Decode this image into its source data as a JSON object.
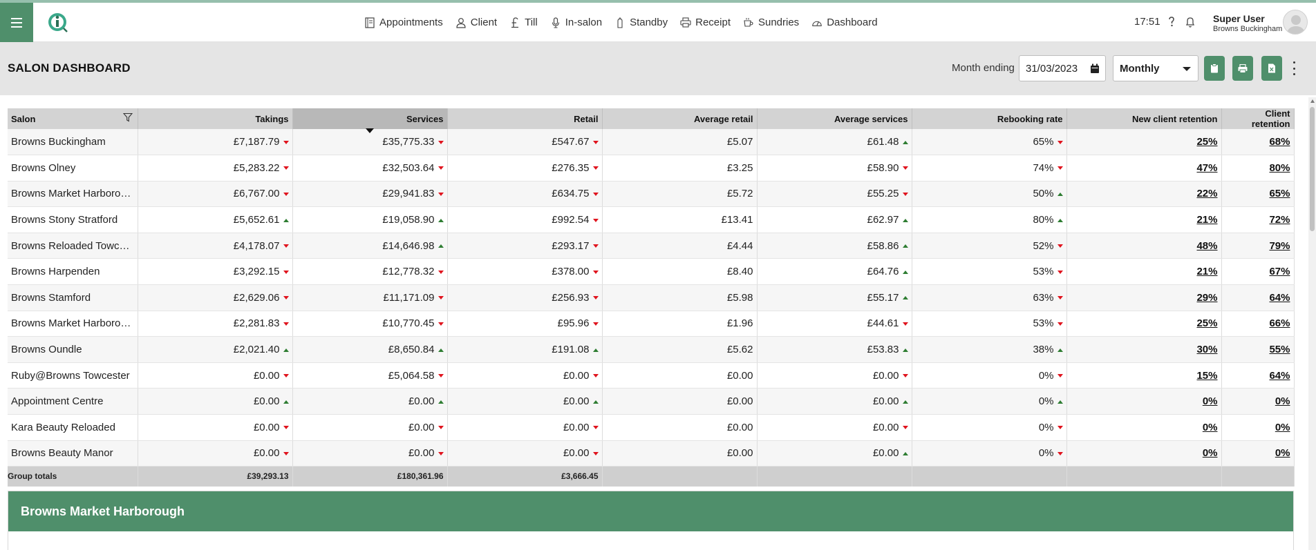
{
  "nav": {
    "items": [
      {
        "label": "Appointments",
        "icon": "book-icon"
      },
      {
        "label": "Client",
        "icon": "user-icon"
      },
      {
        "label": "Till",
        "icon": "pound-icon"
      },
      {
        "label": "In-salon",
        "icon": "microphone-icon"
      },
      {
        "label": "Standby",
        "icon": "hand-icon"
      },
      {
        "label": "Receipt",
        "icon": "printer-icon"
      },
      {
        "label": "Sundries",
        "icon": "coffee-icon"
      },
      {
        "label": "Dashboard",
        "icon": "gauge-icon"
      }
    ]
  },
  "header": {
    "time": "17:51",
    "user_name": "Super User",
    "user_salon": "Browns Buckingham"
  },
  "subbar": {
    "title": "SALON DASHBOARD",
    "month_label": "Month ending",
    "date_value": "31/03/2023",
    "period_value": "Monthly"
  },
  "table": {
    "columns": [
      "Salon",
      "Takings",
      "Services",
      "Retail",
      "Average retail",
      "Average services",
      "Rebooking rate",
      "New client retention",
      "Client retention"
    ],
    "rows": [
      {
        "salon": "Browns Buckingham",
        "takings": "£7,187.79",
        "takings_dir": "down",
        "services": "£35,775.33",
        "services_dir": "down",
        "retail": "£547.67",
        "retail_dir": "down",
        "avg_retail": "£5.07",
        "avg_services": "£61.48",
        "avg_services_dir": "up",
        "rebooking": "65%",
        "rebooking_dir": "down",
        "new_retention": "25%",
        "retention": "68%"
      },
      {
        "salon": "Browns Olney",
        "takings": "£5,283.22",
        "takings_dir": "down",
        "services": "£32,503.64",
        "services_dir": "down",
        "retail": "£276.35",
        "retail_dir": "down",
        "avg_retail": "£3.25",
        "avg_services": "£58.90",
        "avg_services_dir": "down",
        "rebooking": "74%",
        "rebooking_dir": "down",
        "new_retention": "47%",
        "retention": "80%"
      },
      {
        "salon": "Browns Market Harborough",
        "takings": "£6,767.00",
        "takings_dir": "down",
        "services": "£29,941.83",
        "services_dir": "down",
        "retail": "£634.75",
        "retail_dir": "down",
        "avg_retail": "£5.72",
        "avg_services": "£55.25",
        "avg_services_dir": "down",
        "rebooking": "50%",
        "rebooking_dir": "up",
        "new_retention": "22%",
        "retention": "65%"
      },
      {
        "salon": "Browns Stony Stratford",
        "takings": "£5,652.61",
        "takings_dir": "up",
        "services": "£19,058.90",
        "services_dir": "up",
        "retail": "£992.54",
        "retail_dir": "down",
        "avg_retail": "£13.41",
        "avg_services": "£62.97",
        "avg_services_dir": "up",
        "rebooking": "80%",
        "rebooking_dir": "up",
        "new_retention": "21%",
        "retention": "72%"
      },
      {
        "salon": "Browns Reloaded Towcester",
        "takings": "£4,178.07",
        "takings_dir": "down",
        "services": "£14,646.98",
        "services_dir": "up",
        "retail": "£293.17",
        "retail_dir": "down",
        "avg_retail": "£4.44",
        "avg_services": "£58.86",
        "avg_services_dir": "up",
        "rebooking": "52%",
        "rebooking_dir": "down",
        "new_retention": "48%",
        "retention": "79%"
      },
      {
        "salon": "Browns Harpenden",
        "takings": "£3,292.15",
        "takings_dir": "down",
        "services": "£12,778.32",
        "services_dir": "down",
        "retail": "£378.00",
        "retail_dir": "down",
        "avg_retail": "£8.40",
        "avg_services": "£64.76",
        "avg_services_dir": "up",
        "rebooking": "53%",
        "rebooking_dir": "down",
        "new_retention": "21%",
        "retention": "67%"
      },
      {
        "salon": "Browns Stamford",
        "takings": "£2,629.06",
        "takings_dir": "down",
        "services": "£11,171.09",
        "services_dir": "down",
        "retail": "£256.93",
        "retail_dir": "down",
        "avg_retail": "£5.98",
        "avg_services": "£55.17",
        "avg_services_dir": "up",
        "rebooking": "63%",
        "rebooking_dir": "down",
        "new_retention": "29%",
        "retention": "64%"
      },
      {
        "salon": "Browns Market Harborough",
        "takings": "£2,281.83",
        "takings_dir": "down",
        "services": "£10,770.45",
        "services_dir": "down",
        "retail": "£95.96",
        "retail_dir": "down",
        "avg_retail": "£1.96",
        "avg_services": "£44.61",
        "avg_services_dir": "down",
        "rebooking": "53%",
        "rebooking_dir": "down",
        "new_retention": "25%",
        "retention": "66%"
      },
      {
        "salon": "Browns Oundle",
        "takings": "£2,021.40",
        "takings_dir": "up",
        "services": "£8,650.84",
        "services_dir": "up",
        "retail": "£191.08",
        "retail_dir": "up",
        "avg_retail": "£5.62",
        "avg_services": "£53.83",
        "avg_services_dir": "up",
        "rebooking": "38%",
        "rebooking_dir": "up",
        "new_retention": "30%",
        "retention": "55%"
      },
      {
        "salon": "Ruby@Browns Towcester",
        "takings": "£0.00",
        "takings_dir": "down",
        "services": "£5,064.58",
        "services_dir": "down",
        "retail": "£0.00",
        "retail_dir": "down",
        "avg_retail": "£0.00",
        "avg_services": "£0.00",
        "avg_services_dir": "down",
        "rebooking": "0%",
        "rebooking_dir": "down",
        "new_retention": "15%",
        "retention": "64%"
      },
      {
        "salon": "Appointment Centre",
        "takings": "£0.00",
        "takings_dir": "up",
        "services": "£0.00",
        "services_dir": "up",
        "retail": "£0.00",
        "retail_dir": "up",
        "avg_retail": "£0.00",
        "avg_services": "£0.00",
        "avg_services_dir": "up",
        "rebooking": "0%",
        "rebooking_dir": "up",
        "new_retention": "0%",
        "retention": "0%"
      },
      {
        "salon": "Kara Beauty Reloaded",
        "takings": "£0.00",
        "takings_dir": "down",
        "services": "£0.00",
        "services_dir": "down",
        "retail": "£0.00",
        "retail_dir": "down",
        "avg_retail": "£0.00",
        "avg_services": "£0.00",
        "avg_services_dir": "down",
        "rebooking": "0%",
        "rebooking_dir": "down",
        "new_retention": "0%",
        "retention": "0%"
      },
      {
        "salon": "Browns Beauty Manor",
        "takings": "£0.00",
        "takings_dir": "down",
        "services": "£0.00",
        "services_dir": "down",
        "retail": "£0.00",
        "retail_dir": "down",
        "avg_retail": "£0.00",
        "avg_services": "£0.00",
        "avg_services_dir": "up",
        "rebooking": "0%",
        "rebooking_dir": "down",
        "new_retention": "0%",
        "retention": "0%"
      }
    ],
    "totals": {
      "label": "Group totals",
      "takings": "£39,293.13",
      "services": "£180,361.96",
      "retail": "£3,666.45"
    }
  },
  "panel": {
    "title": "Browns Market Harborough"
  },
  "colors": {
    "brand_green": "#4f8f6b",
    "down_red": "#e0141e",
    "up_green": "#2e7d32"
  }
}
